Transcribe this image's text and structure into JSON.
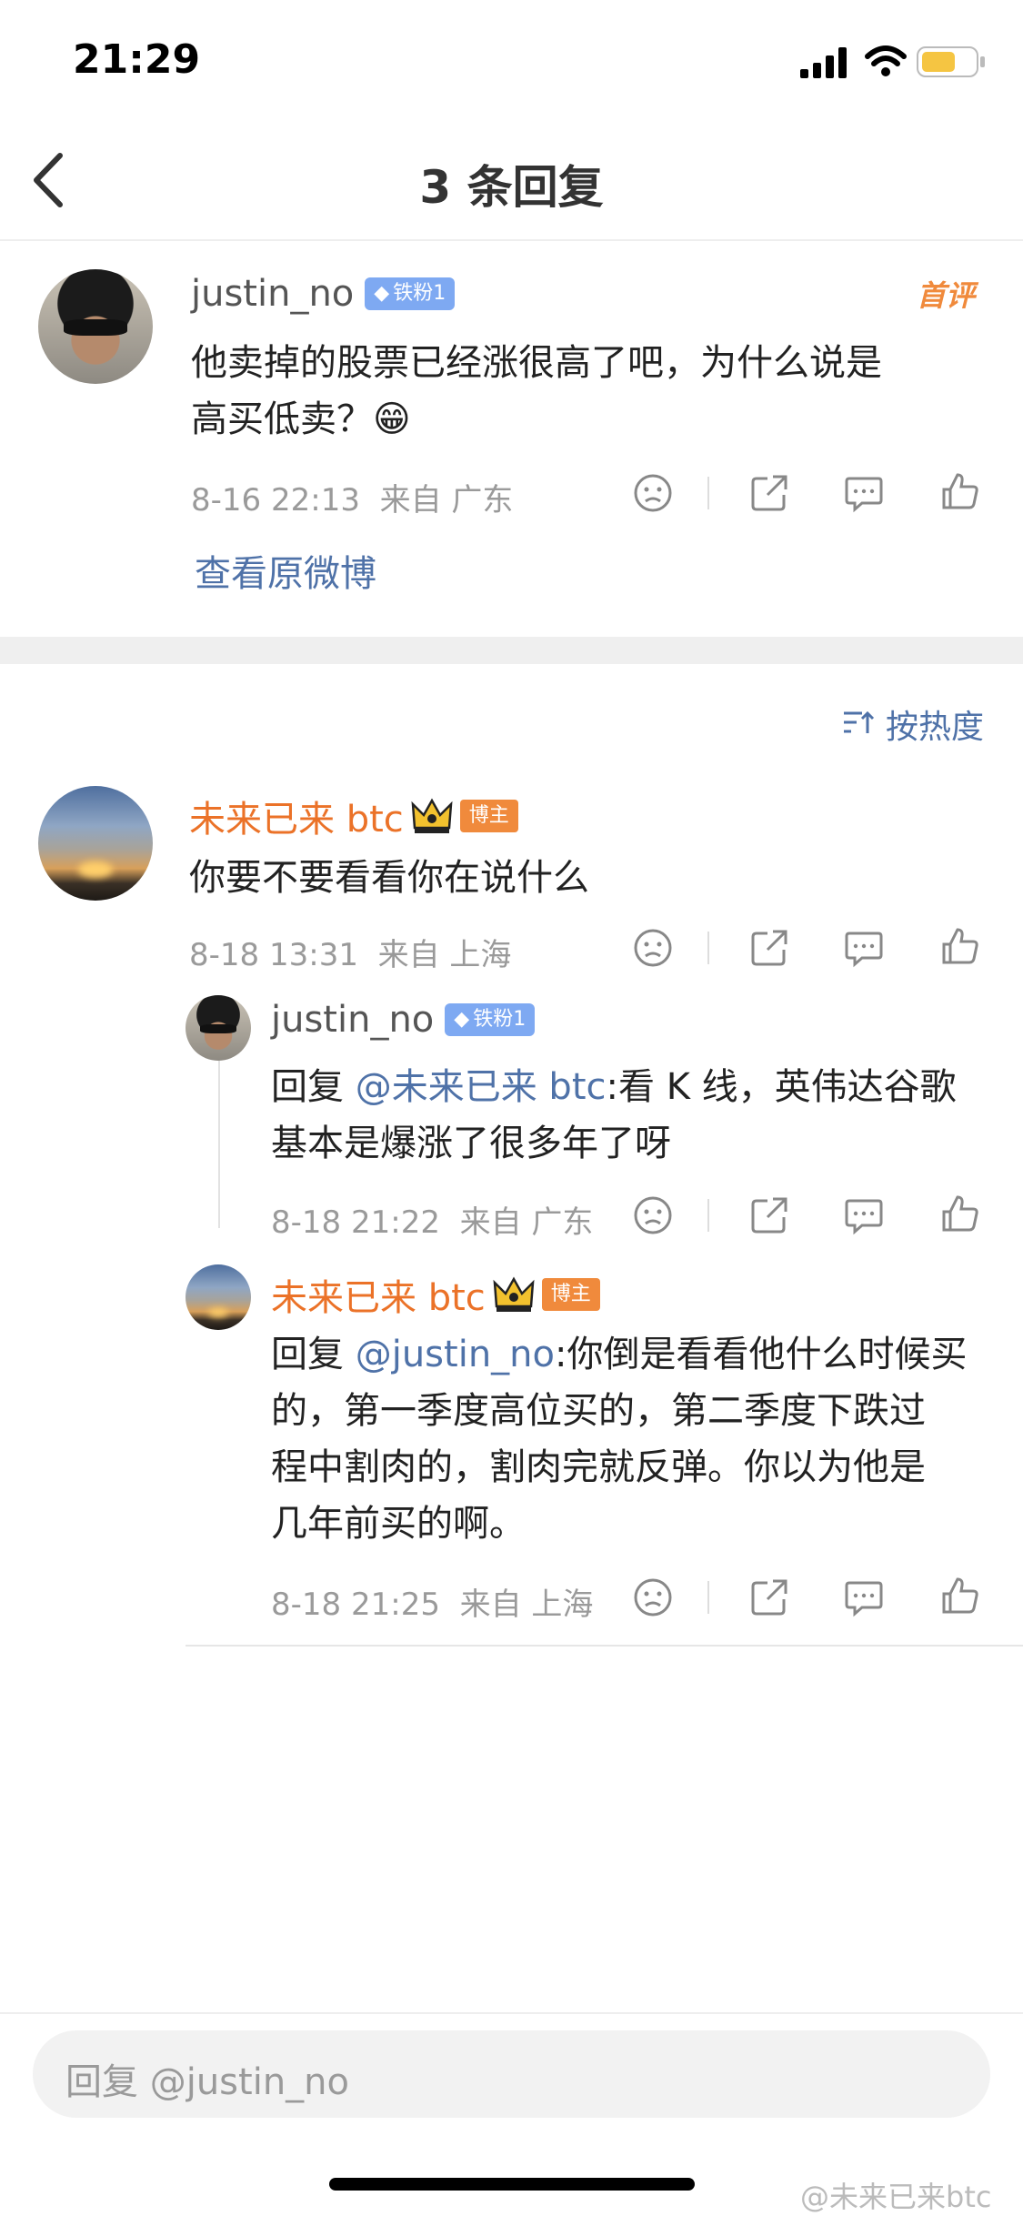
{
  "status_bar": {
    "time": "21:29"
  },
  "nav": {
    "title": "3 条回复"
  },
  "root_comment": {
    "username": "justin_no",
    "badge": "铁粉1",
    "tag": "首评",
    "text_line1": "他卖掉的股票已经涨很高了吧，为什么说是",
    "text_line2": "高买低卖？",
    "emoji": "😁",
    "meta": "8-16 22:13  来自 广东",
    "view_original": "查看原微博"
  },
  "sort": {
    "label": "按热度"
  },
  "replies": [
    {
      "username": "未来已来 btc",
      "badge": "博主",
      "text": "你要不要看看你在说什么",
      "meta": "8-18 13:31  来自 上海"
    },
    {
      "username": "justin_no",
      "badge": "铁粉1",
      "reply_prefix": "回复 ",
      "mention": "@未来已来 btc",
      "text_line1_rest": ":看 K 线，英伟达谷歌",
      "text_line2": "基本是爆涨了很多年了呀",
      "meta": "8-18 21:22  来自 广东"
    },
    {
      "username": "未来已来 btc",
      "badge": "博主",
      "reply_prefix": "回复 ",
      "mention": "@justin_no",
      "text_line1_rest": ":你倒是看看他什么时候买",
      "text_line2": "的，第一季度高位买的，第二季度下跌过",
      "text_line3": "程中割肉的，割肉完就反弹。你以为他是",
      "text_line4": "几年前买的啊。",
      "meta": "8-18 21:25  来自 上海"
    }
  ],
  "input": {
    "placeholder": "回复 @justin_no"
  },
  "watermark": "@未来已来btc",
  "colors": {
    "link": "#4f72a8",
    "author_orange": "#eb7228",
    "fan_badge": "#7ea9f2",
    "host_badge": "#f08a3c"
  }
}
